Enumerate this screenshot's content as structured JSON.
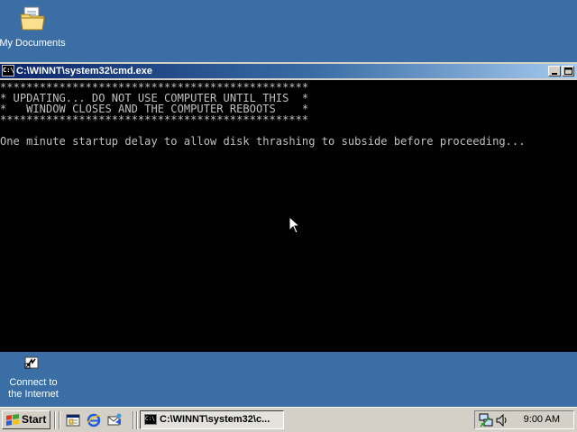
{
  "desktop": {
    "icons": [
      {
        "label": "My Documents",
        "icon": "folder-documents-icon"
      },
      {
        "label_lines": [
          "Connect to",
          "the Internet"
        ],
        "icon": "connect-internet-icon"
      }
    ],
    "background_color": "#3a6ea5"
  },
  "console_window": {
    "title": "C:\\WINNT\\system32\\cmd.exe",
    "icon": "command-prompt-icon",
    "caption_buttons": [
      "restore-icon",
      "maximize-icon"
    ],
    "lines": [
      "***********************************************",
      "* UPDATING... DO NOT USE COMPUTER UNTIL THIS  *",
      "*   WINDOW CLOSES AND THE COMPUTER REBOOTS    *",
      "***********************************************",
      "",
      "One minute startup delay to allow disk thrashing to subside before proceeding..."
    ]
  },
  "taskbar": {
    "start_label": "Start",
    "quick_launch": [
      "show-desktop-icon",
      "internet-explorer-icon",
      "outlook-express-icon"
    ],
    "tasks": [
      {
        "label": "C:\\WINNT\\system32\\c...",
        "icon": "command-prompt-icon",
        "active": true
      }
    ],
    "tray": {
      "icons": [
        "network-icon",
        "volume-icon"
      ],
      "clock": "9:00 AM"
    }
  }
}
